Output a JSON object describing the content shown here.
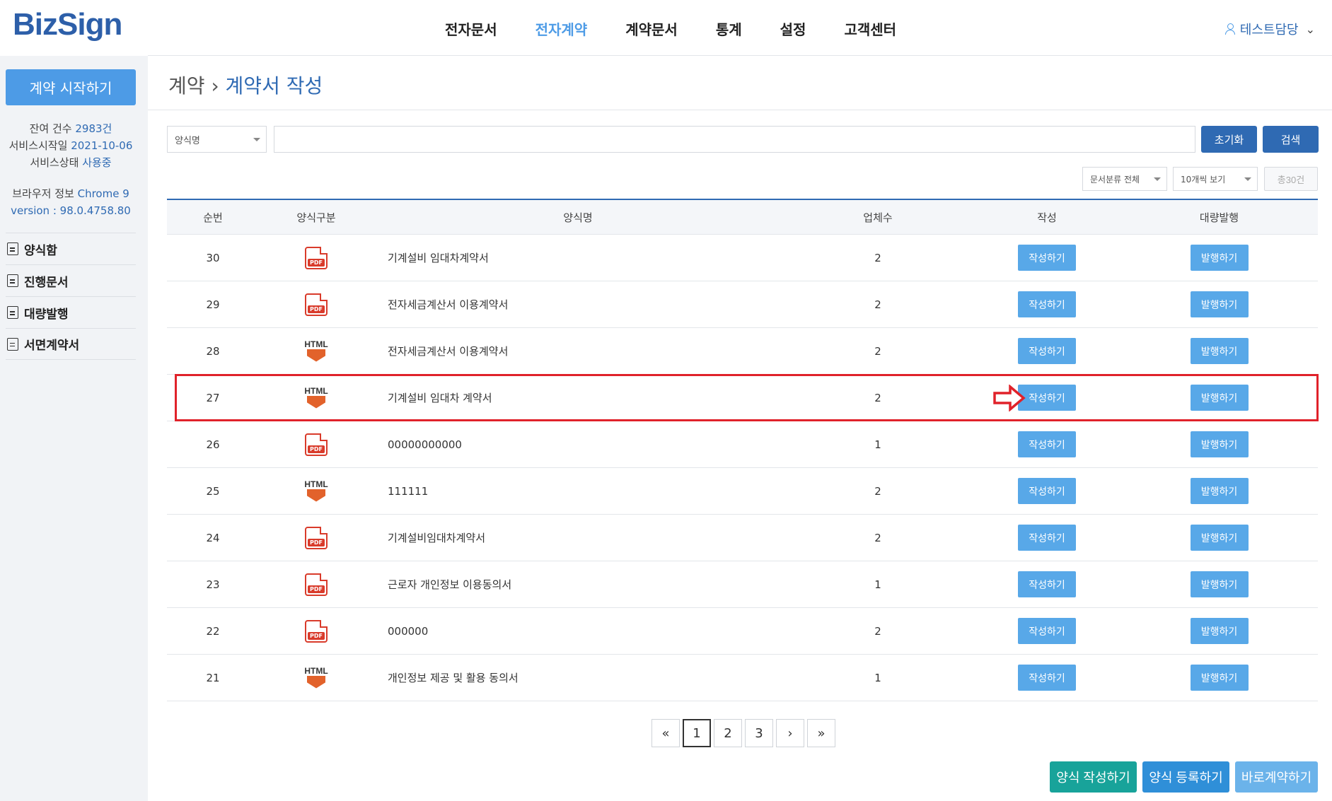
{
  "logo": "BizSign",
  "sidebar": {
    "start_button": "계약 시작하기",
    "remaining_label": "잔여 건수 ",
    "remaining_value": "2983건",
    "service_start_label": "서비스시작일 ",
    "service_start_value": "2021-10-06",
    "service_status_label": "서비스상태 ",
    "service_status_value": "사용중",
    "browser_label": "브라우저 정보 ",
    "browser_value": "Chrome 9",
    "version_label": "version : ",
    "version_value": "98.0.4758.80",
    "menu": [
      "양식함",
      "진행문서",
      "대량발행",
      "서면계약서"
    ]
  },
  "nav": {
    "items": [
      "전자문서",
      "전자계약",
      "계약문서",
      "통계",
      "설정",
      "고객센터"
    ],
    "active_index": 1,
    "user": "테스트담당"
  },
  "breadcrumb": {
    "parent": "계약",
    "separator": "›",
    "current": "계약서 작성"
  },
  "search": {
    "field_select": "양식명",
    "reset_label": "초기화",
    "search_label": "검색",
    "category_select": "문서분류 전체",
    "page_size_select": "10개씩 보기",
    "total_label": "총30건"
  },
  "table": {
    "headers": {
      "no": "순번",
      "type": "양식구분",
      "name": "양식명",
      "count": "업체수",
      "write": "작성",
      "bulk": "대량발행"
    },
    "write_button": "작성하기",
    "bulk_button": "발행하기",
    "html_label": "HTML",
    "pdf_label": "PDF",
    "rows": [
      {
        "no": "30",
        "type": "pdf",
        "name": "기계설비 임대차계약서",
        "count": "2"
      },
      {
        "no": "29",
        "type": "pdf",
        "name": "전자세금계산서 이용계약서",
        "count": "2"
      },
      {
        "no": "28",
        "type": "html",
        "name": "전자세금계산서 이용계약서",
        "count": "2"
      },
      {
        "no": "27",
        "type": "html",
        "name": "기계설비 임대차 계약서",
        "count": "2"
      },
      {
        "no": "26",
        "type": "pdf",
        "name": "00000000000",
        "count": "1"
      },
      {
        "no": "25",
        "type": "html",
        "name": "111111",
        "count": "2"
      },
      {
        "no": "24",
        "type": "pdf",
        "name": "기계설비임대차계약서",
        "count": "2"
      },
      {
        "no": "23",
        "type": "pdf",
        "name": "근로자 개인정보 이용동의서",
        "count": "1"
      },
      {
        "no": "22",
        "type": "pdf",
        "name": "000000",
        "count": "2"
      },
      {
        "no": "21",
        "type": "html",
        "name": "개인정보 제공 및 활용 동의서",
        "count": "1"
      }
    ],
    "highlighted_row_index": 3
  },
  "pagination": {
    "first": "«",
    "pages": [
      "1",
      "2",
      "3"
    ],
    "next": "›",
    "last": "»",
    "active": "1"
  },
  "actions": {
    "write_form": "양식 작성하기",
    "register_form": "양식 등록하기",
    "direct_contract": "바로계약하기"
  },
  "colors": {
    "brand": "#2d5fa9",
    "accent": "#4d9be6",
    "dark_button": "#2f6ab3",
    "action_button": "#58a8e8",
    "teal_button": "#18a39a",
    "highlight": "#e0222a"
  }
}
